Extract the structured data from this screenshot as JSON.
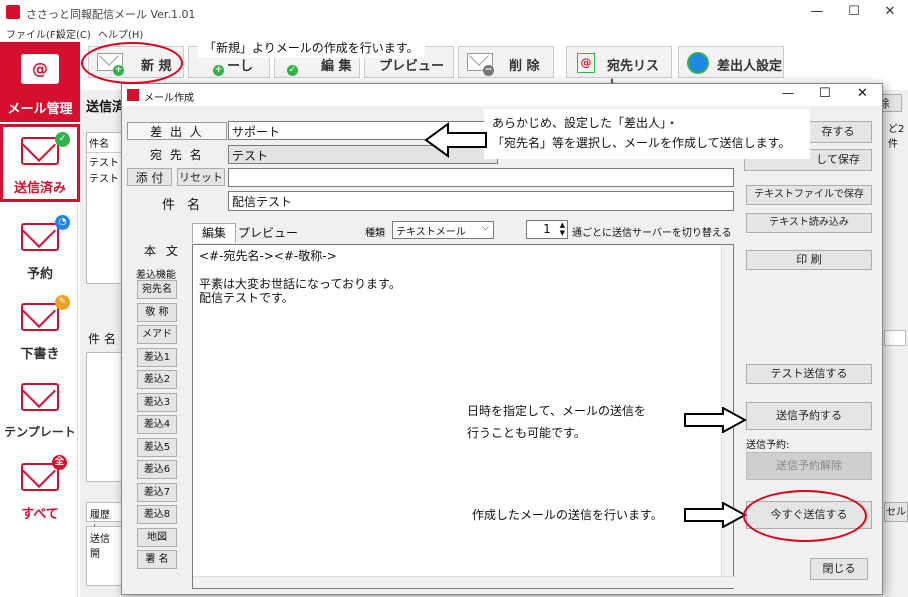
{
  "app": {
    "title": "ささっと同報配信メール Ver.1.01",
    "window_controls": {
      "minimize": "—",
      "maximize": "☐",
      "close": "✕"
    }
  },
  "menu": [
    "ファイル(F)",
    "設定(C)",
    "ヘルプ(H)"
  ],
  "sidebar": [
    {
      "label": "メール管理",
      "icon": "mail-at-icon",
      "active": true
    },
    {
      "label": "送信済み",
      "icon": "sent-mail-icon",
      "selected": true
    },
    {
      "label": "予約",
      "icon": "scheduled-mail-icon"
    },
    {
      "label": "下書き",
      "icon": "draft-mail-icon"
    },
    {
      "label": "テンプレート",
      "icon": "template-mail-icon"
    },
    {
      "label": "すべて",
      "icon": "all-mail-icon",
      "badge": "全"
    }
  ],
  "toolbar": {
    "new": "新 規",
    "edit_partial": "ーし",
    "edit2_partial": "編 集",
    "preview_partial": "プレビュー",
    "delete": "削 除",
    "recipients": "宛先リスト",
    "sender_settings": "差出人設定"
  },
  "background": {
    "sent_label": "送信済",
    "list_col": "件名",
    "list_rows": [
      "テスト",
      "テスト"
    ],
    "subject_label": "件 名",
    "history_label": "履歴ク",
    "send_col": "送信開",
    "right_btn_partial": "除",
    "right_col_partial": "ど2件",
    "right_bottom_partial": "セル"
  },
  "dialog": {
    "title": "メール作成",
    "sender_label": "差 出 人",
    "sender_value": "サポート",
    "recipient_label": "宛 先 名",
    "recipient_value": "テスト",
    "attach_label": "添 付",
    "reset_label": "リセット",
    "subject_label": "件 名",
    "subject_value": "配信テスト",
    "tab_edit": "編集",
    "tab_preview": "プレビュー",
    "type_label": "種類",
    "type_value": "テキストメール",
    "server_count": "1",
    "server_note": "通ごとに送信サーバーを切り替える",
    "body_label": "本 文",
    "insert_label": "差込機能",
    "insert_buttons": [
      "宛先名",
      "敬 称",
      "メアド",
      "差込1",
      "差込2",
      "差込3",
      "差込4",
      "差込5",
      "差込6",
      "差込7",
      "差込8",
      "地図URL",
      "署 名"
    ],
    "body_lines": [
      "<#-宛先名-><#-敬称->",
      "",
      "平素は大変お世話になっております。",
      "配信テストです。"
    ],
    "right_buttons": {
      "save_partial": "存する",
      "save_as_partial": "して保存",
      "save_text": "テキストファイルで保存",
      "load_text": "テキスト読み込み",
      "print": "印 刷",
      "test_send": "テスト送信する",
      "reserve_send": "送信予約する",
      "reserve_label": "送信予約:",
      "reserve_cancel": "送信予約解除",
      "send_now": "今すぐ送信する",
      "close": "閉じる"
    }
  },
  "annotations": {
    "new_note": "「新規」よりメールの作成を行います。",
    "sender_note_1": "あらかじめ、設定した「差出人」・",
    "sender_note_2": "「宛先名」等を選択し、メールを作成して送信します。",
    "schedule_note_1": "日時を指定して、メールの送信を",
    "schedule_note_2": "行うことも可能です。",
    "send_note": "作成したメールの送信を行います。"
  },
  "colors": {
    "brand_red": "#d5102f",
    "annotation_red": "#e0001b",
    "green_badge": "#2fb34a",
    "blue_badge": "#1e88e5",
    "orange_badge": "#f0a020"
  }
}
